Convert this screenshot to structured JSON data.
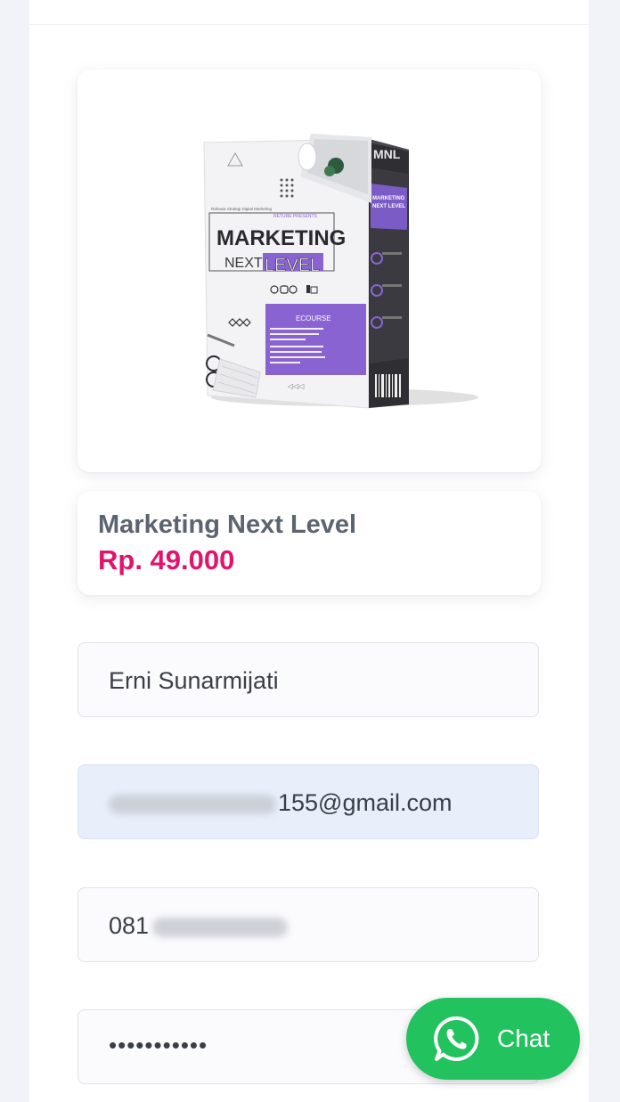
{
  "product": {
    "box": {
      "presents": "RETURE PRESENTS",
      "tagline": "Rahasia Strategi Digital Marketing",
      "title_main": "MARKETING",
      "title_next": "NEXT",
      "title_level": "LEVEL",
      "ecourse": "ECOURSE",
      "side_logo": "MNL",
      "side_title_1": "MARKETING",
      "side_title_2": "NEXT LEVEL"
    },
    "name": "Marketing Next Level",
    "price": "Rp. 49.000"
  },
  "form": {
    "name_value": "Erni Sunarmijati",
    "email_visible": "155@gmail.com",
    "phone_visible": "081",
    "password_value": "•••••••••••"
  },
  "chat": {
    "label": "Chat",
    "icon": "whatsapp-icon",
    "color": "#22c35e"
  },
  "colors": {
    "price": "#e3126c",
    "accent_purple": "#8a63d2"
  }
}
